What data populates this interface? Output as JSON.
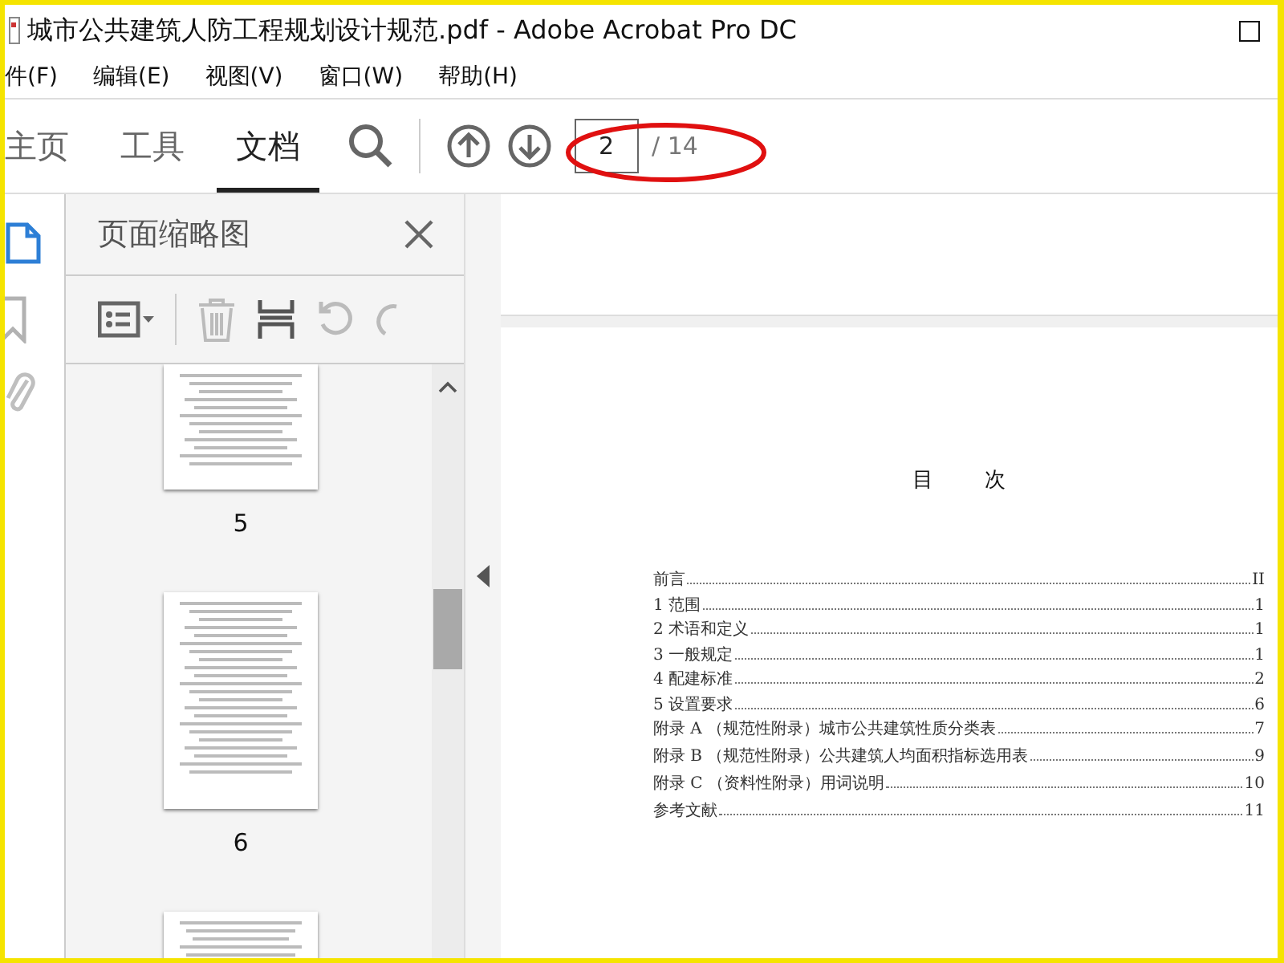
{
  "window": {
    "title": "城市公共建筑人防工程规划设计规范.pdf - Adobe Acrobat Pro DC"
  },
  "menu": [
    "件(F)",
    "编辑(E)",
    "视图(V)",
    "窗口(W)",
    "帮助(H)"
  ],
  "tabs": [
    {
      "label": "主页",
      "selected": false
    },
    {
      "label": "工具",
      "selected": false
    },
    {
      "label": "文档",
      "selected": true
    }
  ],
  "page_nav": {
    "current": "2",
    "total": "/ 14"
  },
  "side_rail": [
    {
      "kind": "pages",
      "selected": true
    },
    {
      "kind": "bookmarks",
      "selected": false
    },
    {
      "kind": "attachments",
      "selected": false
    }
  ],
  "panel": {
    "title": "页面缩略图",
    "thumbnails": [
      {
        "label": "5"
      },
      {
        "label": "6"
      }
    ]
  },
  "document": {
    "heading": "目 次",
    "toc": [
      {
        "title": "前言",
        "page": "II"
      },
      {
        "title": "1 范围",
        "page": "1"
      },
      {
        "title": "2 术语和定义",
        "page": "1"
      },
      {
        "title": "3 一般规定",
        "page": "1"
      },
      {
        "title": "4 配建标准",
        "page": "2"
      },
      {
        "title": "5 设置要求",
        "page": "6"
      },
      {
        "title": "附录 A （规范性附录）城市公共建筑性质分类表",
        "page": "7"
      },
      {
        "title": "附录 B （规范性附录）公共建筑人均面积指标选用表",
        "page": "9"
      },
      {
        "title": "附录 C （资料性附录）用词说明",
        "page": "10"
      },
      {
        "title": "参考文献",
        "page": "11"
      }
    ]
  }
}
